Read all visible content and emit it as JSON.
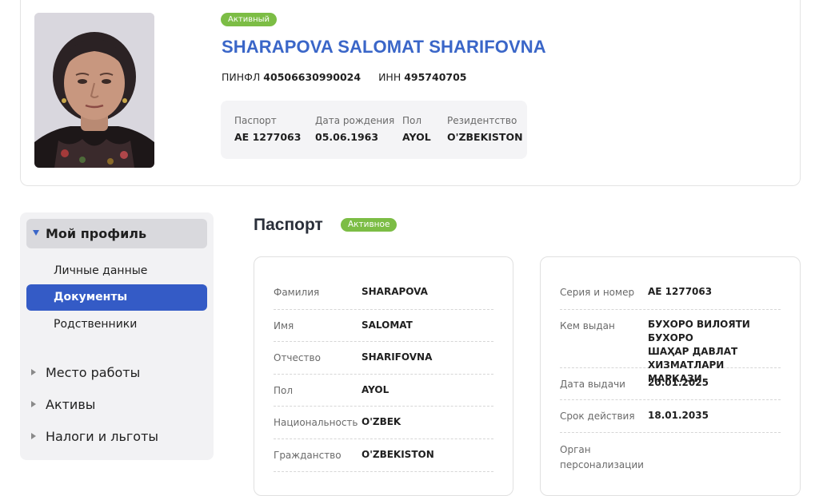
{
  "profile": {
    "status": "Активный",
    "name": "SHARAPOVA SALOMAT SHARIFOVNA",
    "pinfl_label": "ПИНФЛ",
    "pinfl": "40506630990024",
    "inn_label": "ИНН",
    "inn": "495740705",
    "info": [
      {
        "label": "Паспорт",
        "value": "AE 1277063"
      },
      {
        "label": "Дата рождения",
        "value": "05.06.1963"
      },
      {
        "label": "Пол",
        "value": "AYOL"
      },
      {
        "label": "Резидентство",
        "value": "O'ZBEKISTON"
      }
    ]
  },
  "sidebar": {
    "section": "Мой профиль",
    "subitems": [
      "Личные данные",
      "Документы",
      "Родственники"
    ],
    "items": [
      "Место работы",
      "Активы",
      "Налоги и льготы"
    ]
  },
  "passport": {
    "title": "Паспорт",
    "status": "Активное",
    "left": [
      {
        "label": "Фамилия",
        "value": "SHARAPOVA"
      },
      {
        "label": "Имя",
        "value": "SALOMAT"
      },
      {
        "label": "Отчество",
        "value": "SHARIFOVNA"
      },
      {
        "label": "Пол",
        "value": "AYOL"
      },
      {
        "label": "Национальность",
        "value": "O'ZBEK"
      },
      {
        "label": "Гражданство",
        "value": "O'ZBEKISTON"
      }
    ],
    "right": [
      {
        "label": "Серия и номер",
        "value": "AE 1277063"
      },
      {
        "label": "Кем выдан",
        "value_lines": [
          "БУХОРО ВИЛОЯТИ БУХОРО",
          "ШАҲАР ДАВЛАТ",
          "ХИЗМАТЛАРИ МАРКАЗИ"
        ]
      },
      {
        "label": "Дата выдачи",
        "value": "20.01.2025"
      },
      {
        "label": "Срок действия",
        "value": "18.01.2035"
      },
      {
        "label_lines": [
          "Орган",
          "персонализации"
        ],
        "value": ""
      }
    ]
  }
}
